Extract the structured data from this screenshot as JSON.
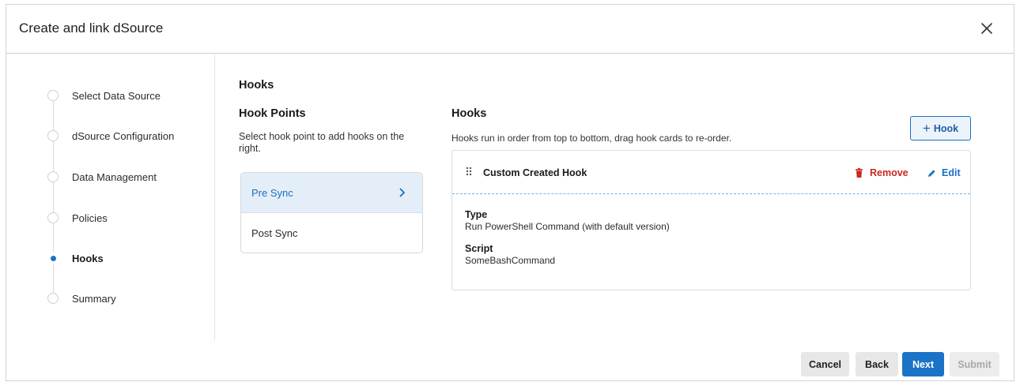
{
  "dialog": {
    "title": "Create and link dSource"
  },
  "stepper": {
    "steps": [
      {
        "label": "Select Data Source",
        "active": false
      },
      {
        "label": "dSource Configuration",
        "active": false
      },
      {
        "label": "Data Management",
        "active": false
      },
      {
        "label": "Policies",
        "active": false
      },
      {
        "label": "Hooks",
        "active": true
      },
      {
        "label": "Summary",
        "active": false
      }
    ]
  },
  "main": {
    "section_title": "Hooks",
    "hook_points": {
      "title": "Hook Points",
      "description": "Select hook point to add hooks on the right.",
      "items": [
        {
          "label": "Pre Sync",
          "selected": true
        },
        {
          "label": "Post Sync",
          "selected": false
        }
      ]
    },
    "hooks": {
      "title": "Hooks",
      "description": "Hooks run in order from top to bottom, drag hook cards to re-order.",
      "add_button_label": "Hook",
      "cards": [
        {
          "name": "Custom Created Hook",
          "remove_label": "Remove",
          "edit_label": "Edit",
          "type_label": "Type",
          "type_value": "Run PowerShell Command (with default version)",
          "script_label": "Script",
          "script_value": "SomeBashCommand"
        }
      ]
    }
  },
  "footer": {
    "cancel_label": "Cancel",
    "back_label": "Back",
    "next_label": "Next",
    "submit_label": "Submit"
  },
  "colors": {
    "accent": "#1b73c8",
    "selected_bg": "#e4eef8",
    "danger": "#c8281e"
  },
  "icons": {
    "close": "close-icon",
    "chevron": "chevron-right-icon",
    "drag": "drag-handle-icon",
    "remove": "trash-icon",
    "edit": "pencil-icon",
    "add": "plus-icon"
  }
}
